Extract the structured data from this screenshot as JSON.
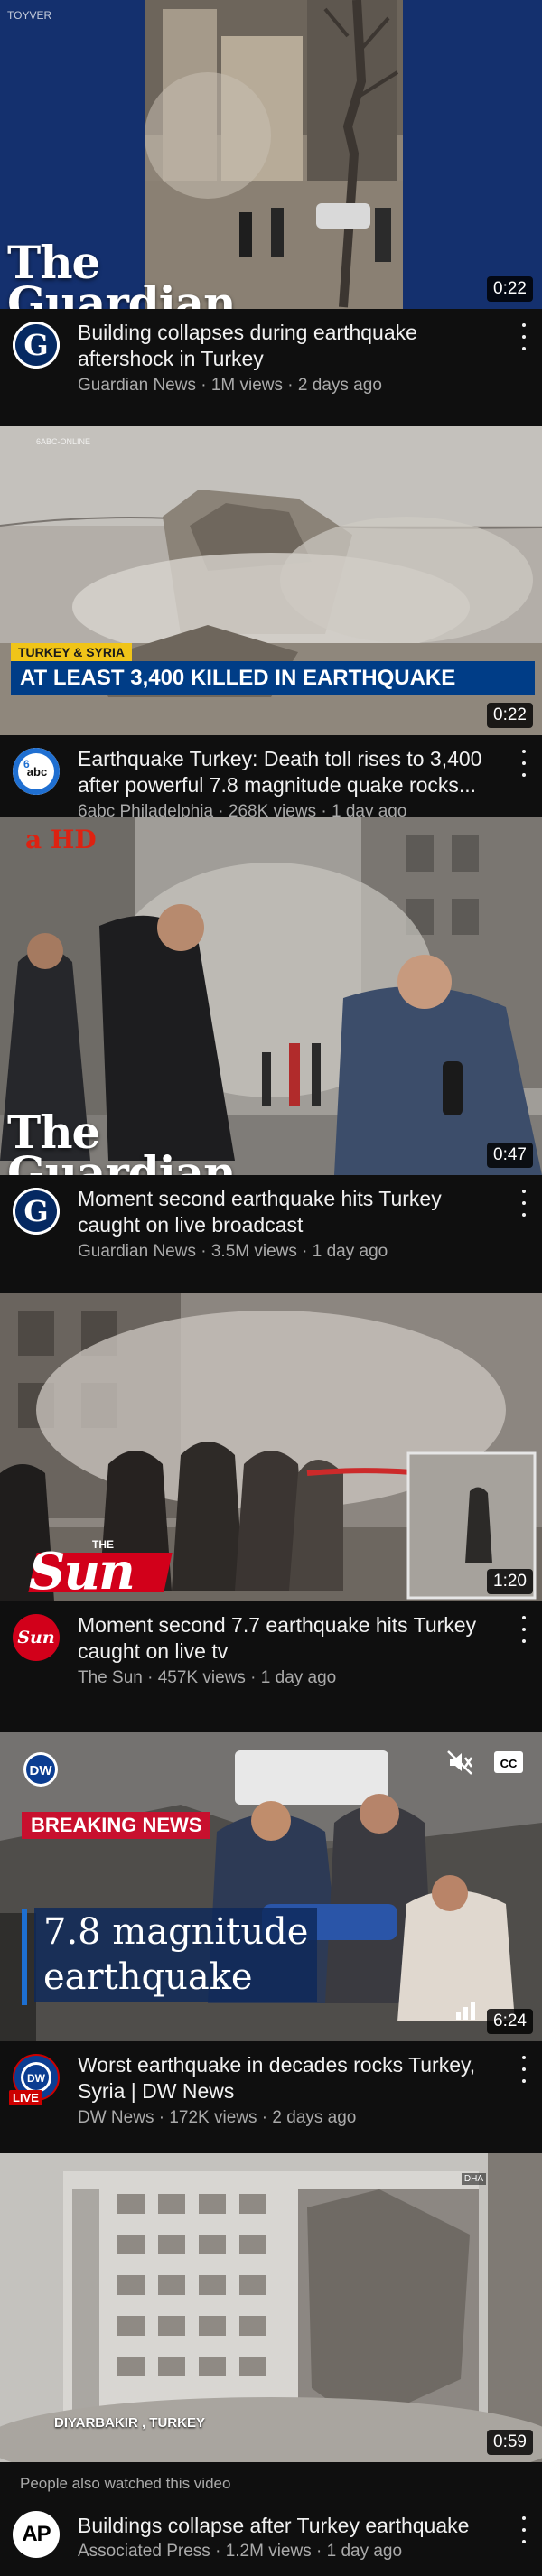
{
  "colors": {
    "background": "#0f0f0f",
    "title_text": "#f1f1f1",
    "secondary_text": "#aaaaaa",
    "guardian_blue": "#052962",
    "sun_red": "#d2001a",
    "dw_blue": "#0b3d91",
    "live_red": "#cc0000",
    "lower_third_blue": "#003d87"
  },
  "videos": [
    {
      "thumb_watermark": "TOYVER",
      "brand": "The Guardian",
      "duration": "0:22",
      "channel_icon": "guardian-g-icon",
      "title": "Building collapses during earthquake aftershock in Turkey",
      "channel": "Guardian News",
      "views": "1M views",
      "age": "2 days ago"
    },
    {
      "thumb_watermark": "6ABC-ONLINE",
      "overlay_tag": "TURKEY & SYRIA",
      "overlay_headline": "AT LEAST 3,400 KILLED IN EARTHQUAKE",
      "duration": "0:22",
      "channel_icon": "abc-circle-icon",
      "title": "Earthquake Turkey: Death toll rises to 3,400 after powerful 7.8 magnitude quake rocks...",
      "channel": "6abc Philadelphia",
      "views": "268K views",
      "age": "1 day ago"
    },
    {
      "thumb_watermark": "a HD",
      "brand": "The Guardian",
      "duration": "0:47",
      "channel_icon": "guardian-g-icon",
      "title": "Moment second earthquake hits Turkey caught on live broadcast",
      "channel": "Guardian News",
      "views": "3.5M views",
      "age": "1 day ago"
    },
    {
      "brand": "THE Sun",
      "brand_small": "THE",
      "brand_main": "Sun",
      "duration": "1:20",
      "channel_icon": "sun-logo-icon",
      "channel_icon_text": "Sun",
      "title": "Moment second 7.7 earthquake hits Turkey caught on live tv",
      "channel": "The Sun",
      "views": "457K views",
      "age": "1 day ago"
    },
    {
      "brand": "DW",
      "breaking": "BREAKING NEWS",
      "headline_line1": "7.8 magnitude",
      "headline_line2": "earthquake",
      "duration": "6:24",
      "channel_icon": "dw-logo-icon",
      "live_label": "LIVE",
      "title": "Worst earthquake in decades rocks Turkey, Syria | DW News",
      "channel": "DW News",
      "views": "172K views",
      "age": "2 days ago"
    },
    {
      "location": "DIYARBAKIR , TURKEY",
      "corner_badge": "DHA",
      "duration": "0:59",
      "channel_icon": "ap-logo-icon",
      "channel_icon_text": "AP",
      "title": "Buildings collapse after Turkey earthquake",
      "channel": "Associated Press",
      "views": "1.2M views",
      "age": "1 day ago"
    }
  ],
  "section": {
    "people_also_watched": "People also watched this video"
  }
}
